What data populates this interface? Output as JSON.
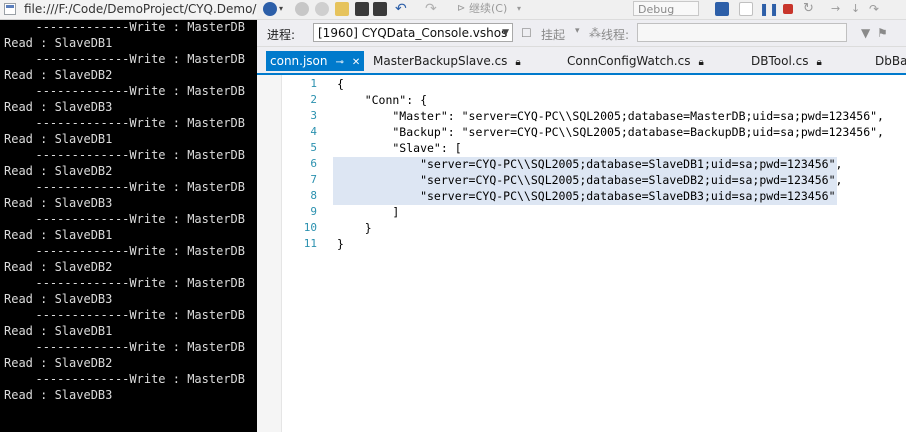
{
  "console": {
    "title": "file:///F:/Code/DemoProject/CYQ.Demo/",
    "lines": [
      "-------------Write : MasterDB",
      "Read : SlaveDB1",
      "-------------Write : MasterDB",
      "Read : SlaveDB2",
      "-------------Write : MasterDB",
      "Read : SlaveDB3",
      "-------------Write : MasterDB",
      "Read : SlaveDB1",
      "-------------Write : MasterDB",
      "Read : SlaveDB2",
      "-------------Write : MasterDB",
      "Read : SlaveDB3",
      "-------------Write : MasterDB",
      "Read : SlaveDB1",
      "-------------Write : MasterDB",
      "Read : SlaveDB2",
      "-------------Write : MasterDB",
      "Read : SlaveDB3",
      "-------------Write : MasterDB",
      "Read : SlaveDB1",
      "-------------Write : MasterDB",
      "Read : SlaveDB2",
      "-------------Write : MasterDB",
      "Read : SlaveDB3"
    ]
  },
  "toolbar": {
    "continue_label": "继续(C)",
    "config_value": "Debug"
  },
  "process_bar": {
    "process_label": "进程:",
    "process_value": "[1960] CYQData_Console.vshos",
    "suspend_label": "挂起",
    "thread_label": "线程:"
  },
  "tabs": [
    {
      "label": "conn.json",
      "active": true
    },
    {
      "label": "MasterBackupSlave.cs"
    },
    {
      "label": "ConnConfigWatch.cs"
    },
    {
      "label": "DBTool.cs"
    },
    {
      "label": "DbBa"
    }
  ],
  "editor": {
    "line_numbers": [
      "1",
      "2",
      "3",
      "4",
      "5",
      "6",
      "7",
      "8",
      "9",
      "10",
      "11"
    ],
    "code_lines": [
      "{",
      "    \"Conn\": {",
      "        \"Master\": \"server=CYQ-PC\\\\SQL2005;database=MasterDB;uid=sa;pwd=123456\",",
      "        \"Backup\": \"server=CYQ-PC\\\\SQL2005;database=BackupDB;uid=sa;pwd=123456\",",
      "        \"Slave\": [",
      "            \"server=CYQ-PC\\\\SQL2005;database=SlaveDB1;uid=sa;pwd=123456\",",
      "            \"server=CYQ-PC\\\\SQL2005;database=SlaveDB2;uid=sa;pwd=123456\",",
      "            \"server=CYQ-PC\\\\SQL2005;database=SlaveDB3;uid=sa;pwd=123456\"",
      "        ]",
      "    }",
      "}"
    ]
  }
}
